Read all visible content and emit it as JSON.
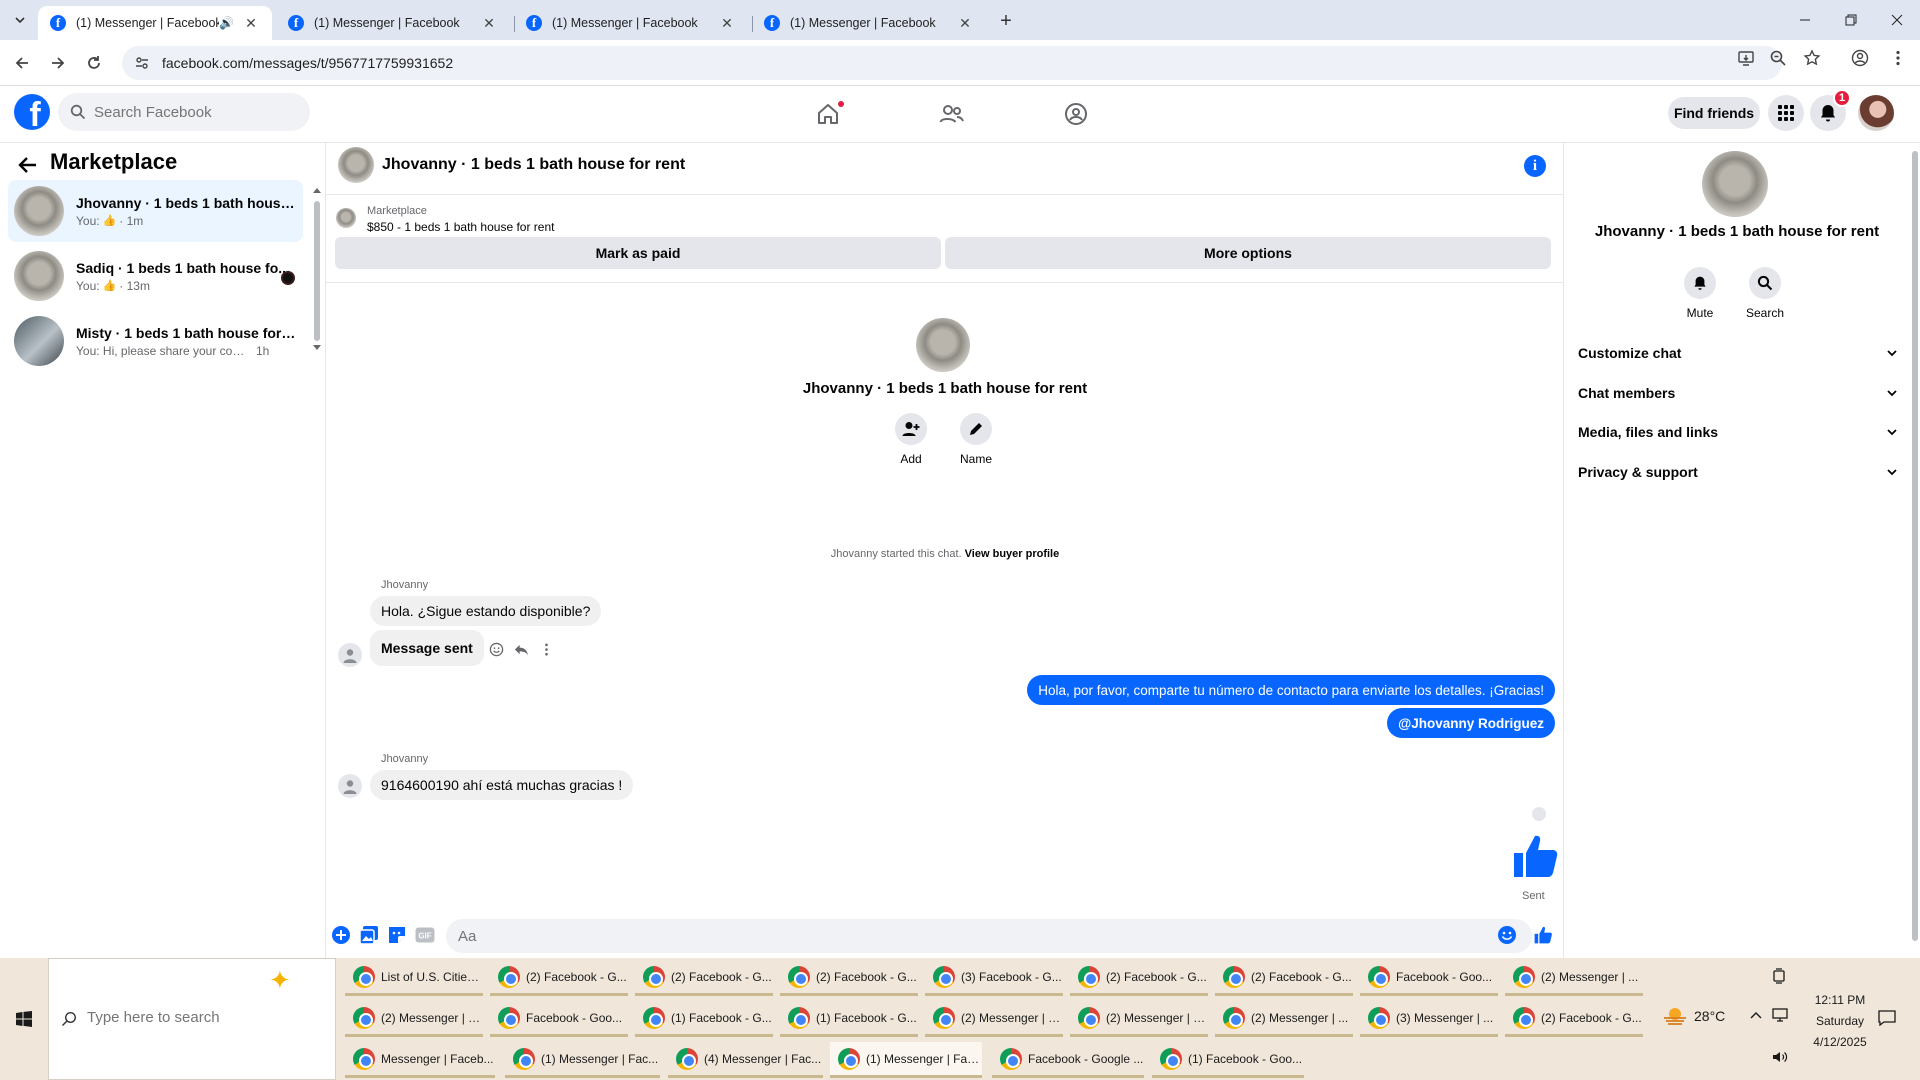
{
  "browser": {
    "tabs": [
      {
        "title": "(1) Messenger | Facebook",
        "active": true,
        "audio": true
      },
      {
        "title": "(1) Messenger | Facebook",
        "active": false
      },
      {
        "title": "(1) Messenger | Facebook",
        "active": false
      },
      {
        "title": "(1) Messenger | Facebook",
        "active": false
      }
    ],
    "favicon_letter": "f",
    "url": "facebook.com/messages/t/9567717759931652"
  },
  "fb_header": {
    "logo_letter": "f",
    "search_placeholder": "Search Facebook",
    "find_friends_label": "Find friends",
    "notification_count": "1",
    "brand_color": "#0866ff"
  },
  "sidebar": {
    "title": "Marketplace",
    "conversations": [
      {
        "name": "Jhovanny · 1 beds 1 bath house f...",
        "prefix": "You:",
        "time": "· 1m",
        "selected": true
      },
      {
        "name": "Sadiq · 1 beds 1 bath house fo...",
        "prefix": "You:",
        "time": "· 13m",
        "unread": true
      },
      {
        "name": "Misty · 1 beds 1 bath house for r...",
        "prefix": "You: Hi, please share your contact ...",
        "time": "1h"
      }
    ]
  },
  "chat": {
    "title": "Jhovanny · 1 beds 1 bath house for rent",
    "marketplace_label": "Marketplace",
    "listing": "$850 - 1 beds 1 bath house for rent",
    "mark_paid_label": "Mark as paid",
    "more_options_label": "More options",
    "intro_name": "Jhovanny · 1 beds 1 bath house for rent",
    "intro_add_label": "Add",
    "intro_name_label": "Name",
    "started_text": "Jhovanny started this chat.",
    "view_buyer_label": "View buyer profile",
    "messages": [
      {
        "sender": "Jhovanny",
        "text": "Hola. ¿Sigue estando disponible?"
      },
      {
        "text": "Message sent"
      },
      {
        "text": "Hola, por favor, comparte tu número de contacto para enviarte los detalles. ¡Gracias!"
      },
      {
        "text": "@Jhovanny Rodriguez"
      },
      {
        "sender": "Jhovanny",
        "text": "9164600190 ahí está muchas gracias !"
      }
    ],
    "sent_label": "Sent",
    "composer_placeholder": "Aa",
    "gif_label": "GIF"
  },
  "info_panel": {
    "name": "Jhovanny · 1 beds 1 bath house for rent",
    "mute_label": "Mute",
    "search_label": "Search",
    "sections": [
      "Customize chat",
      "Chat members",
      "Media, files and links",
      "Privacy & support"
    ]
  },
  "taskbar": {
    "search_placeholder": "Type here to search",
    "apps_row1": [
      "List of U.S. Cities...",
      "(2) Facebook - G...",
      "(2) Facebook - G...",
      "(2) Facebook - G...",
      "(3) Facebook - G...",
      "(2) Facebook - G...",
      "(2) Facebook - G...",
      "Facebook - Goo...",
      "(2) Messenger | ..."
    ],
    "apps_row2": [
      "(2) Messenger | F...",
      "Facebook - Goo...",
      "(1) Facebook - G...",
      "(1) Facebook - G...",
      "(2) Messenger | F...",
      "(2) Messenger | F...",
      "(2) Messenger | ...",
      "(3) Messenger | ...",
      "(2) Facebook - G..."
    ],
    "apps_row3": [
      "Messenger | Faceb...",
      "(1) Messenger | Fac...",
      "(4) Messenger | Fac...",
      "(1) Messenger | Fac...",
      "Facebook - Google ...",
      "(1) Facebook - Goo..."
    ],
    "weather": "28°C",
    "time": "12:11 PM",
    "day": "Saturday",
    "date": "4/12/2025"
  }
}
